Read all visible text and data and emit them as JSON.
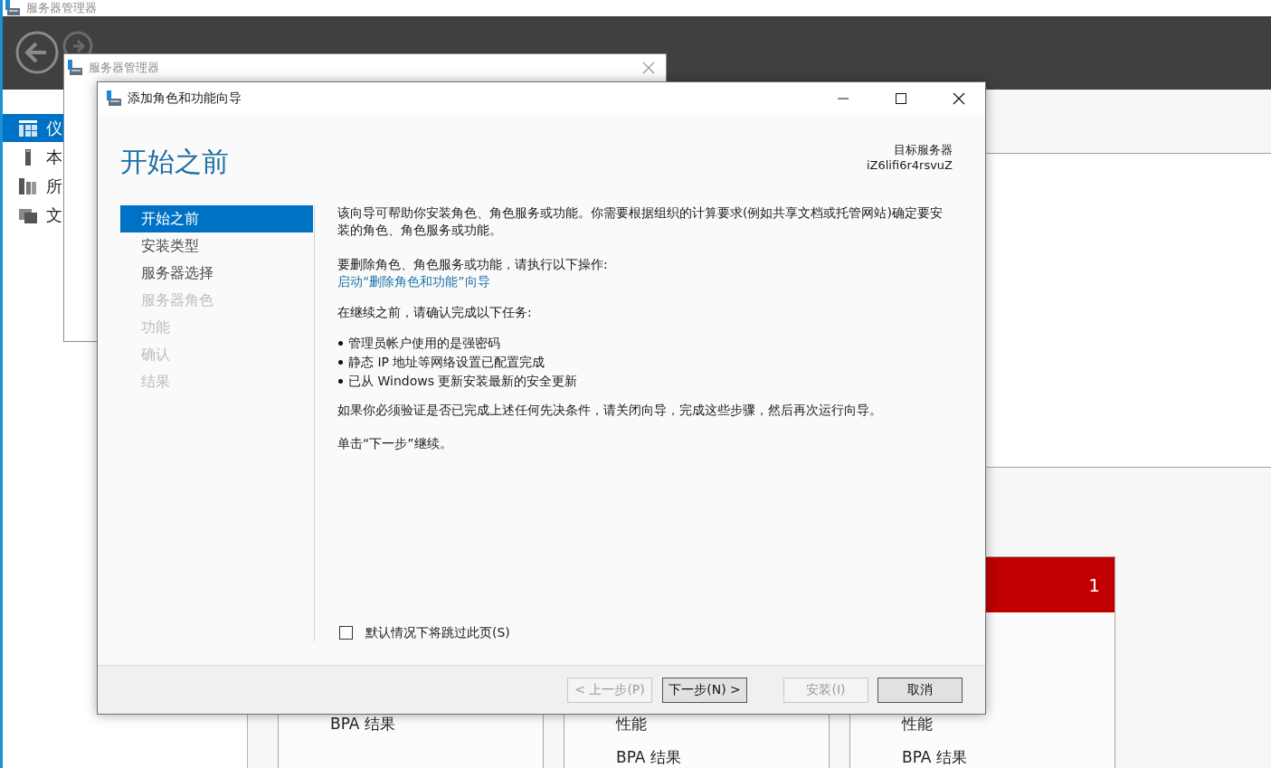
{
  "app_window": {
    "title": "服务器管理器",
    "sidebar": [
      {
        "label": "仪",
        "selected": true
      },
      {
        "label": "本",
        "selected": false
      },
      {
        "label": "所",
        "selected": false
      },
      {
        "label": "文",
        "selected": false
      }
    ],
    "tiles": [
      {
        "rows": [
          "BPA 结果"
        ]
      },
      {
        "rows": [
          "性能",
          "BPA 结果"
        ]
      },
      {
        "header_count": "1",
        "rows": [
          "性能",
          "BPA 结果"
        ]
      }
    ]
  },
  "parent_dialog": {
    "title": "服务器管理器"
  },
  "wizard": {
    "title": "添加角色和功能向导",
    "heading": "开始之前",
    "target_label": "目标服务器",
    "target_server": "iZ6lifi6r4rsvuZ",
    "steps": [
      {
        "label": "开始之前",
        "selected": true,
        "disabled": false
      },
      {
        "label": "安装类型",
        "selected": false,
        "disabled": false
      },
      {
        "label": "服务器选择",
        "selected": false,
        "disabled": false
      },
      {
        "label": "服务器角色",
        "selected": false,
        "disabled": true
      },
      {
        "label": "功能",
        "selected": false,
        "disabled": true
      },
      {
        "label": "确认",
        "selected": false,
        "disabled": true
      },
      {
        "label": "结果",
        "selected": false,
        "disabled": true
      }
    ],
    "intro": "该向导可帮助你安装角色、角色服务或功能。你需要根据组织的计算要求(例如共享文档或托管网站)确定要安装的角色、角色服务或功能。",
    "remove_hint": "要删除角色、角色服务或功能，请执行以下操作:",
    "remove_link": "启动“删除角色和功能”向导",
    "confirm_prompt": "在继续之前，请确认完成以下任务:",
    "tasks": [
      "管理员帐户使用的是强密码",
      "静态 IP 地址等网络设置已配置完成",
      "已从 Windows 更新安装最新的安全更新"
    ],
    "verify_note": "如果你必须验证是否已完成上述任何先决条件，请关闭向导，完成这些步骤，然后再次运行向导。",
    "continue_note": "单击“下一步”继续。",
    "skip_page": {
      "label": "默认情况下将跳过此页(S)",
      "checked": false
    },
    "buttons": [
      {
        "label": "< 上一步(P)",
        "disabled": true
      },
      {
        "label": "下一步(N) >",
        "disabled": false
      },
      {
        "label": "安装(I)",
        "disabled": true
      },
      {
        "label": "取消",
        "disabled": false
      }
    ]
  }
}
